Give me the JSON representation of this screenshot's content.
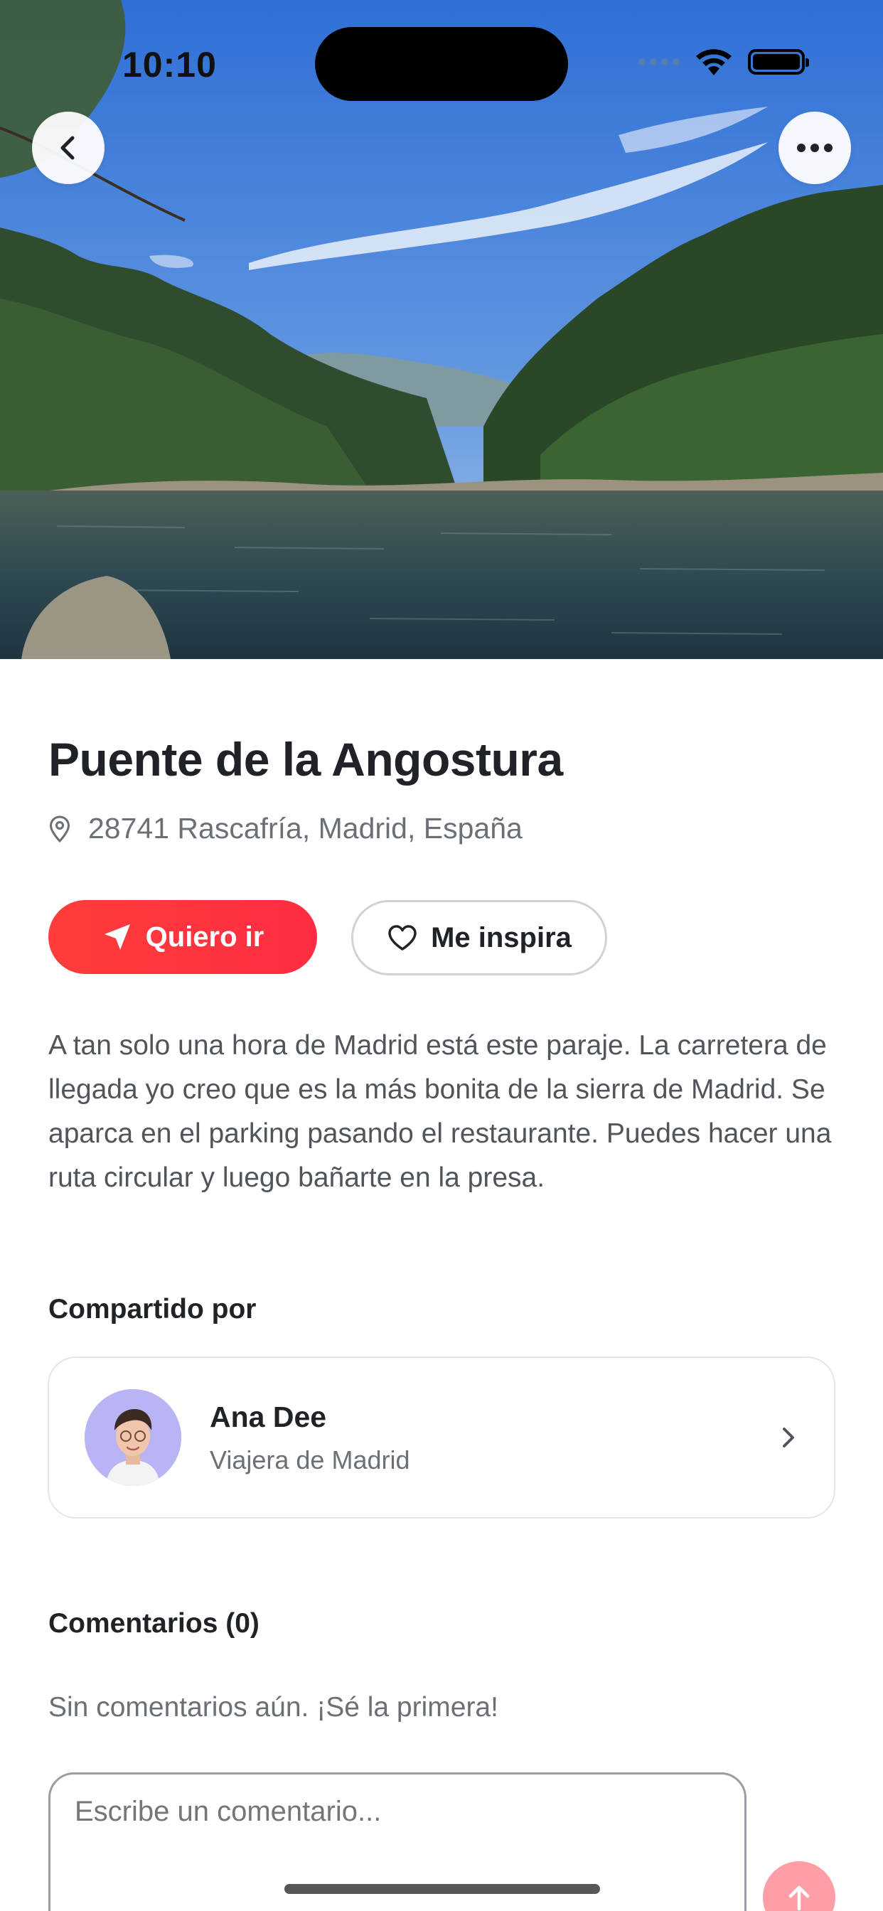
{
  "status_bar": {
    "time": "10:10"
  },
  "hero": {
    "image_alt": "Lake with pine forest and mountains"
  },
  "place": {
    "title": "Puente de la Angostura",
    "address": "28741 Rascafría, Madrid, España"
  },
  "actions": {
    "go_label": "Quiero ir",
    "inspire_label": "Me inspira"
  },
  "description": "A tan solo una hora de Madrid está este paraje. La carretera de llegada yo creo que es la más bonita de la sierra de Madrid. Se aparca en el parking pasando el restaurante. Puedes hacer una ruta circular y luego bañarte en la presa.",
  "shared_by": {
    "heading": "Compartido por",
    "name": "Ana Dee",
    "subtitle": "Viajera de Madrid"
  },
  "comments": {
    "heading": "Comentarios (0)",
    "empty_text": "Sin comentarios aún. ¡Sé la primera!",
    "input_placeholder": "Escribe un comentario..."
  },
  "icons": {
    "back": "chevron-left-icon",
    "more": "ellipsis-icon",
    "location": "map-pin-icon",
    "go": "navigation-arrow-icon",
    "inspire": "heart-icon",
    "author_chevron": "chevron-right-icon",
    "send": "arrow-up-icon"
  },
  "colors": {
    "primary": "#ff3a3d",
    "send_disabled": "#ff9ea6",
    "text": "#1f2226",
    "muted": "#6b7077"
  }
}
